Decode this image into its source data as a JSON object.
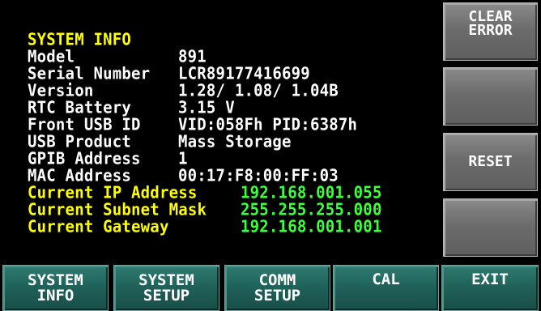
{
  "title": "SYSTEM INFO",
  "info_rows": [
    {
      "label": "Model",
      "value": "891"
    },
    {
      "label": "Serial Number",
      "value": "LCR89177416699"
    },
    {
      "label": "Version",
      "value": "1.28/ 1.08/ 1.04B"
    },
    {
      "label": "RTC Battery",
      "value": "3.15 V"
    },
    {
      "label": "Front USB ID",
      "value": "VID:058Fh PID:6387h"
    },
    {
      "label": "USB Product",
      "value": "Mass Storage"
    },
    {
      "label": "GPIB Address",
      "value": "1"
    },
    {
      "label": "MAC Address",
      "value": "00:17:F8:00:FF:03"
    }
  ],
  "network_rows": [
    {
      "label": "Current IP Address",
      "value": "192.168.001.055"
    },
    {
      "label": "Current Subnet Mask",
      "value": "255.255.255.000"
    },
    {
      "label": "Current Gateway",
      "value": "192.168.001.001"
    }
  ],
  "side_buttons": [
    {
      "label": "CLEAR\nERROR"
    },
    {
      "label": ""
    },
    {
      "label": "RESET"
    },
    {
      "label": ""
    }
  ],
  "bottom_buttons": [
    {
      "label": "SYSTEM\nINFO"
    },
    {
      "label": "SYSTEM\nSETUP"
    },
    {
      "label": "COMM\nSETUP"
    },
    {
      "label": "CAL"
    },
    {
      "label": "EXIT"
    }
  ],
  "colors": {
    "background": "#000000",
    "title": "#ffff00",
    "text": "#ffffff",
    "network_value": "#3cff3c",
    "side_button": "#6c6c6c",
    "bottom_button": "#1f6058"
  }
}
